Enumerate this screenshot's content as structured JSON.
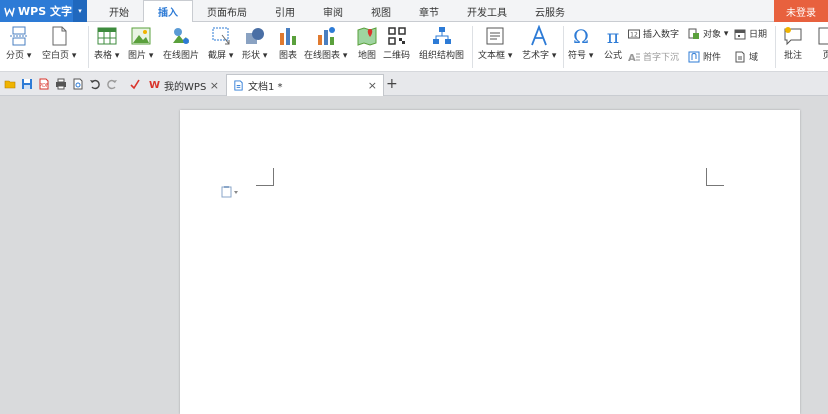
{
  "app": {
    "name": "WPS 文字",
    "login": "未登录"
  },
  "menu_tabs": [
    "开始",
    "插入",
    "页面布局",
    "引用",
    "审阅",
    "视图",
    "章节",
    "开发工具",
    "云服务"
  ],
  "ribbon": {
    "page_break": "分页",
    "blank_page": "空白页",
    "table": "表格",
    "picture": "图片",
    "online_picture": "在线图片",
    "screenshot": "截屏",
    "shape": "形状",
    "chart": "图表",
    "online_chart": "在线图表",
    "map": "地图",
    "qrcode": "二维码",
    "org_chart": "组织结构图",
    "textbox": "文本框",
    "wordart": "艺术字",
    "symbol": "符号",
    "formula": "公式",
    "insert_number": "插入数字",
    "dropcap": "首字下沉",
    "object": "对象",
    "attachment": "附件",
    "date": "日期",
    "field": "域",
    "comment": "批注",
    "page_cut": "页"
  },
  "doc_tabs": [
    {
      "label": "我的WPS",
      "close": "×"
    },
    {
      "label": "文档1 *",
      "close": "×"
    }
  ],
  "add_tab": "+",
  "dropdown_glyph": "▾",
  "colors": {
    "accent": "#2d7bd6",
    "login": "#e8613e",
    "wps_red": "#d9342b"
  }
}
